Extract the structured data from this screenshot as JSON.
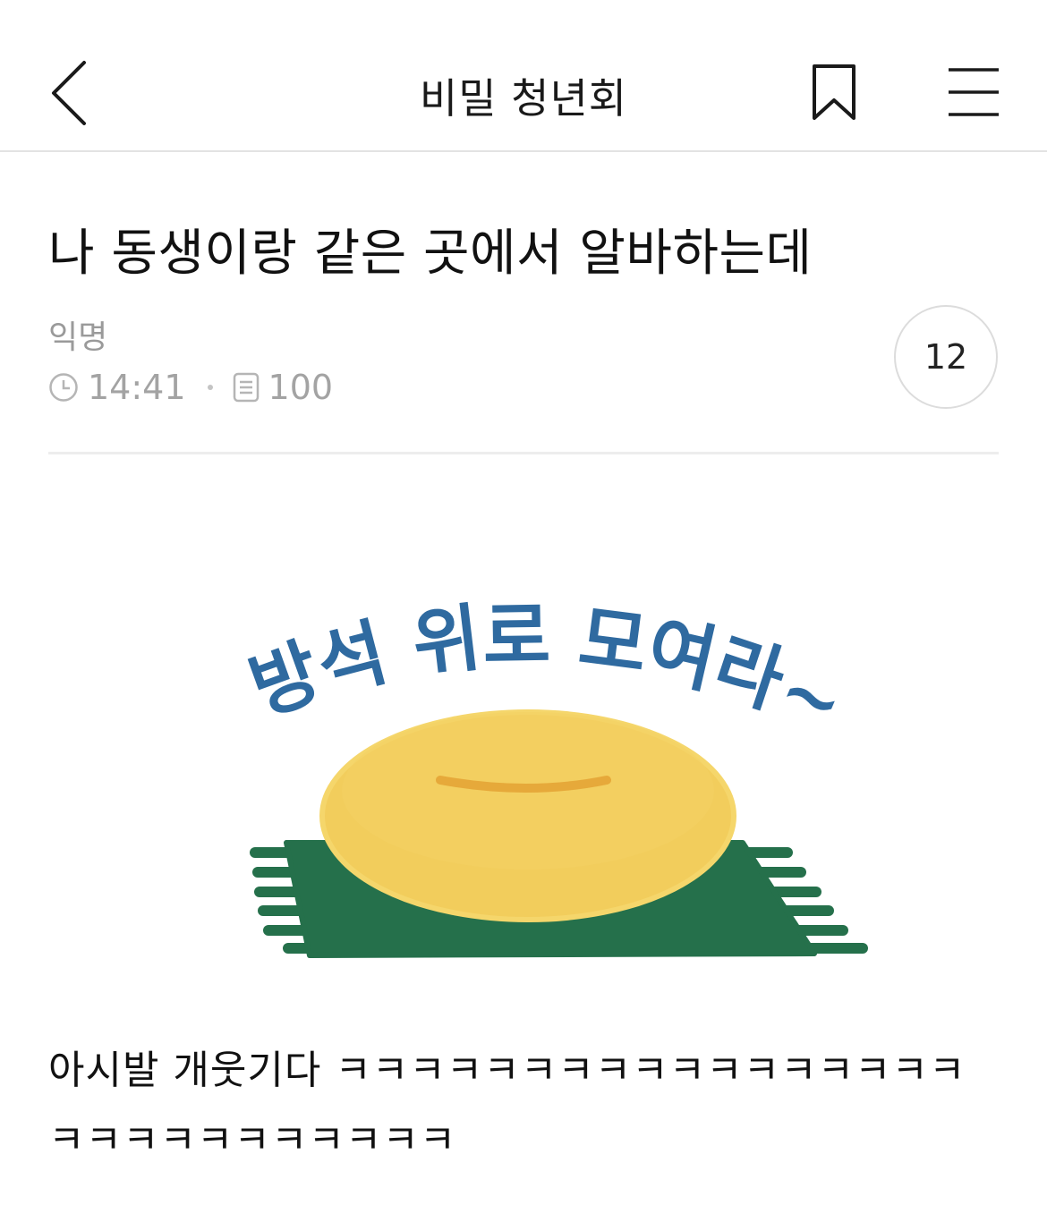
{
  "header": {
    "title": "비밀 청년회",
    "back_icon": "chevron-left-icon",
    "bookmark_icon": "bookmark-icon",
    "menu_icon": "hamburger-menu-icon"
  },
  "post": {
    "title": "나 동생이랑 같은 곳에서 알바하는데",
    "author": "익명",
    "time": "14:41",
    "views": "100",
    "comment_count": "12",
    "body": "아시발 개웃기다 ㅋㅋㅋㅋㅋㅋㅋㅋㅋㅋㅋㅋㅋㅋㅋㅋㅋㅋㅋㅋㅋㅋㅋㅋㅋㅋㅋㅋ"
  },
  "sticker": {
    "text": "방석 위로 모여라~",
    "colors": {
      "text": "#2f6aa0",
      "cushion": "#f2cd5c",
      "mat": "#25704b"
    }
  }
}
